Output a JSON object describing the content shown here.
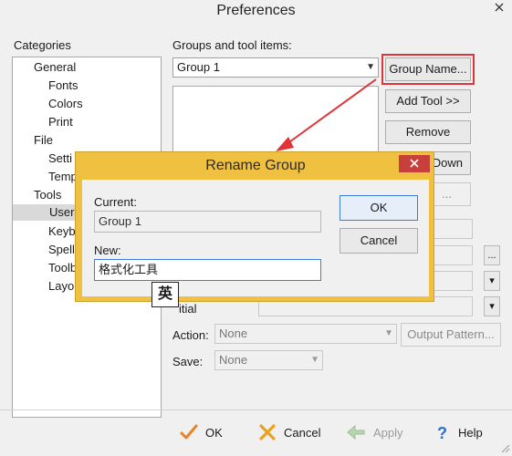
{
  "window": {
    "title": "Preferences"
  },
  "categories": {
    "label": "Categories",
    "items": [
      {
        "label": "General",
        "level": 1
      },
      {
        "label": "Fonts",
        "level": 2
      },
      {
        "label": "Colors",
        "level": 2
      },
      {
        "label": "Print",
        "level": 2
      },
      {
        "label": "File",
        "level": 1
      },
      {
        "label": "Setti",
        "level": 2
      },
      {
        "label": "Temp",
        "level": 2
      },
      {
        "label": "Tools",
        "level": 1
      },
      {
        "label": "User",
        "level": 2,
        "selected": true
      },
      {
        "label": "Keyb",
        "level": 2
      },
      {
        "label": "Spell",
        "level": 2
      },
      {
        "label": "Toolb",
        "level": 2
      },
      {
        "label": "Layou",
        "level": 2
      }
    ]
  },
  "groups": {
    "label": "Groups and tool items:",
    "selected": "Group 1",
    "group_name_button": "Group Name...",
    "add_tool_button": "Add Tool >>",
    "remove_button": "Remove",
    "move_down_button": "Down"
  },
  "fields": {
    "initial_label": "itial",
    "action_label": "Action:",
    "action_value": "None",
    "output_pattern_button": "Output Pattern...",
    "save_label": "Save:",
    "save_value": "None",
    "browse_button": "...",
    "blurred_button": "..."
  },
  "footer": {
    "ok": "OK",
    "cancel": "Cancel",
    "apply": "Apply",
    "help": "Help"
  },
  "dialog": {
    "title": "Rename Group",
    "current_label": "Current:",
    "current_value": "Group 1",
    "new_label": "New:",
    "new_value": "格式化工具",
    "ok": "OK",
    "cancel": "Cancel"
  },
  "ime_indicator": "英",
  "colors": {
    "dialog_frame": "#f0c040",
    "close_button": "#c8403b",
    "highlight_annotation": "#e0333a"
  }
}
